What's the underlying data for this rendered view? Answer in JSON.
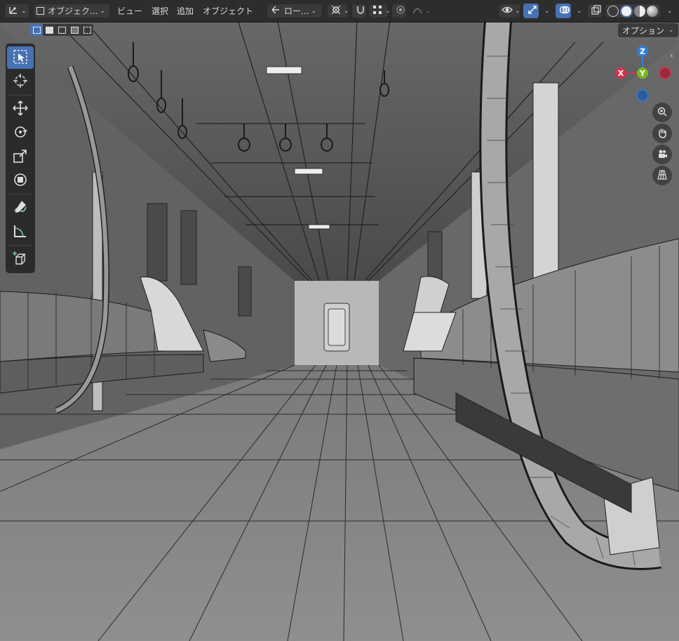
{
  "header": {
    "editor_type_icon": "axes-icon",
    "mode_label": "オブジェク...",
    "menus": [
      "ビュー",
      "選択",
      "追加",
      "オブジェクト"
    ],
    "transform_orientation_label": "ロー...",
    "pivot_icon": "pivot-point-icon",
    "snap_icon": "magnet-icon",
    "snap_target_icon": "grid-snap-icon",
    "proportional_icon": "proportional-edit-icon",
    "falloff_icon": "falloff-curve-icon",
    "visibility_icon": "eye-icon",
    "gizmo_icon": "gizmo-arrows-icon",
    "overlay_icon": "overlay-icon",
    "xray_icon": "xray-icon",
    "shading_modes": [
      "wireframe",
      "solid",
      "material",
      "rendered"
    ],
    "active_shading": "solid"
  },
  "sub_header": {
    "select_modes": [
      "select-set-icon",
      "select-extend-icon",
      "select-subtract-icon",
      "select-invert-icon",
      "select-intersect-icon"
    ],
    "options_label": "オプション"
  },
  "toolbar": {
    "tools": [
      "select-box-icon",
      "cursor-icon",
      "move-icon",
      "rotate-icon",
      "scale-icon",
      "transform-icon",
      "annotate-icon",
      "measure-icon",
      "add-cube-icon"
    ],
    "active_tool": "select-box-icon"
  },
  "gizmo": {
    "axes": [
      "Z",
      "X",
      "Y"
    ],
    "colors": {
      "x": "#d3344f",
      "y": "#78b91c",
      "z": "#2f80d6",
      "neg_x": "#9a2a3c",
      "neg_z": "#2a5e9a"
    }
  },
  "nav_buttons": [
    "zoom-icon",
    "hand-pan-icon",
    "camera-icon",
    "ortho-grid-icon"
  ],
  "colors": {
    "accent": "#4772b3",
    "viewport_floor": "#8a8a8a",
    "viewport_ceiling": "#5a5a5a",
    "header_bg": "#282828"
  }
}
